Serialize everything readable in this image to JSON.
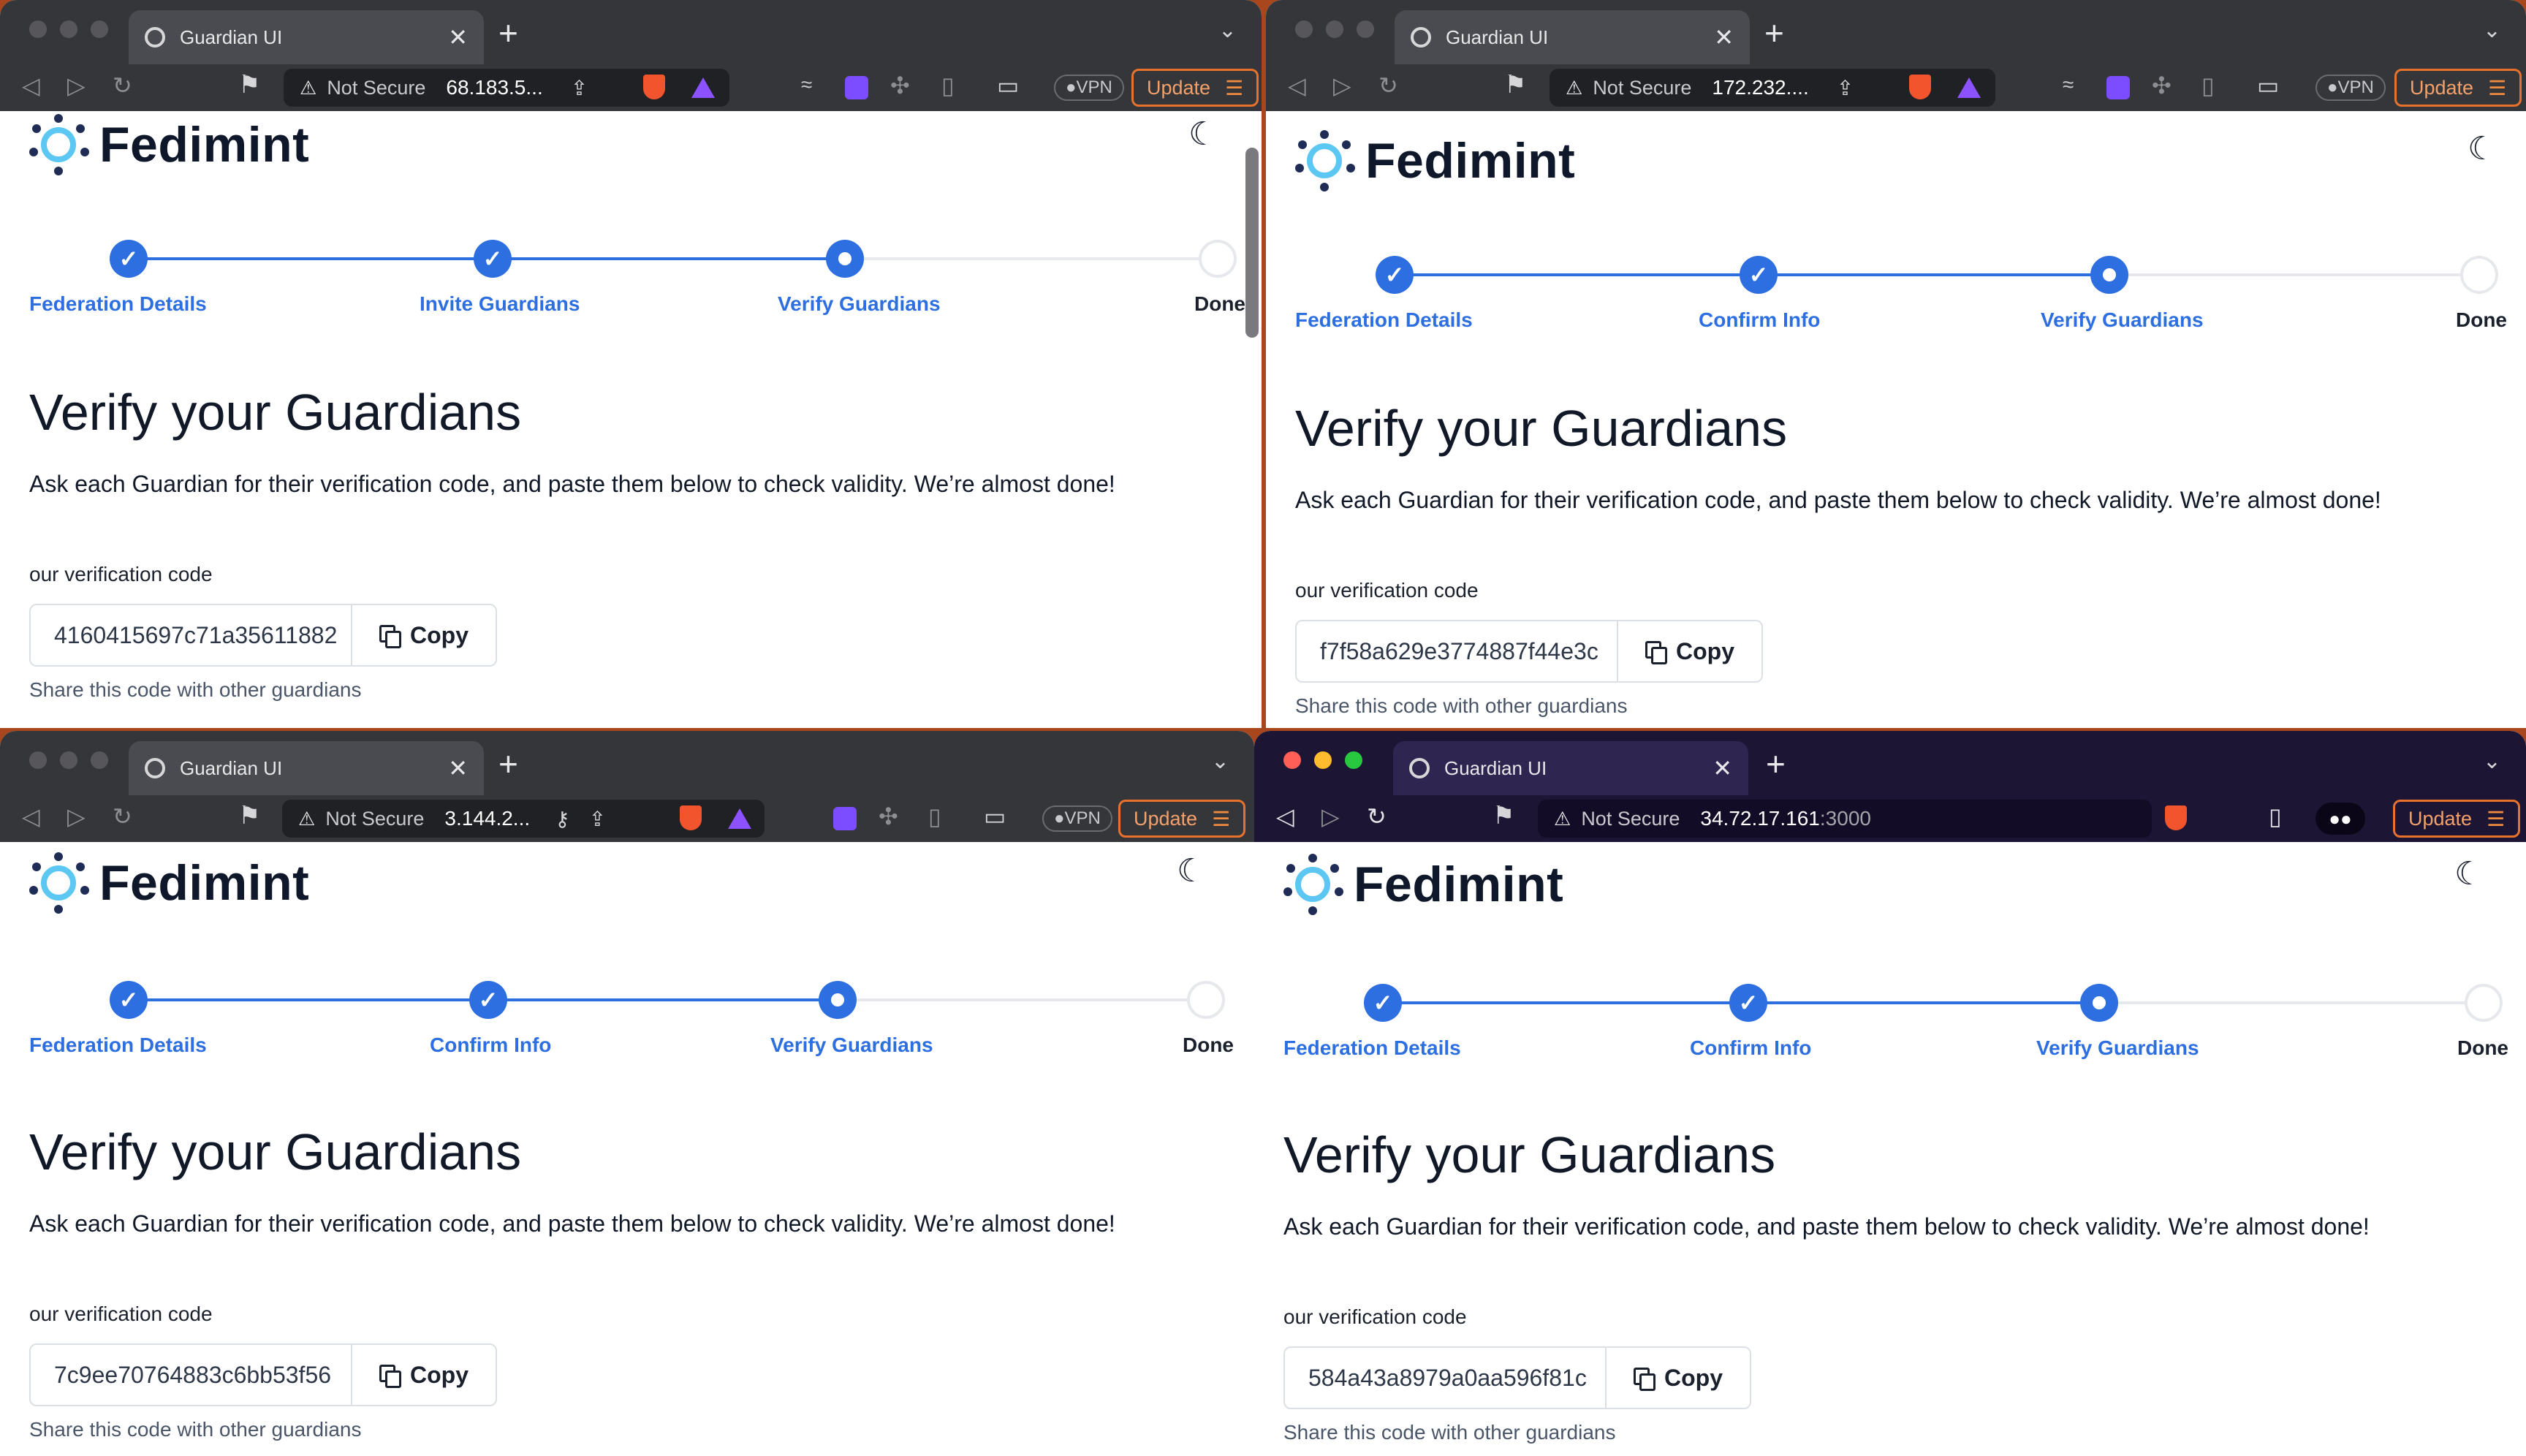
{
  "windows": [
    {
      "tab_title": "Guardian UI",
      "security": "Not Secure",
      "address": "68.183.5...",
      "address_port": "",
      "vpn": "VPN",
      "update": "Update",
      "brand": "Fedimint",
      "steps": [
        "Federation Details",
        "Invite Guardians",
        "Verify Guardians",
        "Done"
      ],
      "heading": "Verify your Guardians",
      "description": "Ask each Guardian for their verification code, and paste them below to check validity. We’re almost done!",
      "code_label": "our verification code",
      "code": "4160415697c71a35611882",
      "copy": "Copy",
      "help": "Share this code with other guardians"
    },
    {
      "tab_title": "Guardian UI",
      "security": "Not Secure",
      "address": "172.232....",
      "address_port": "",
      "vpn": "VPN",
      "update": "Update",
      "brand": "Fedimint",
      "steps": [
        "Federation Details",
        "Confirm Info",
        "Verify Guardians",
        "Done"
      ],
      "heading": "Verify your Guardians",
      "description": "Ask each Guardian for their verification code, and paste them below to check validity. We’re almost done!",
      "code_label": "our verification code",
      "code": "f7f58a629e3774887f44e3c",
      "copy": "Copy",
      "help": "Share this code with other guardians"
    },
    {
      "tab_title": "Guardian UI",
      "security": "Not Secure",
      "address": "3.144.2...",
      "address_port": "",
      "vpn": "VPN",
      "update": "Update",
      "brand": "Fedimint",
      "steps": [
        "Federation Details",
        "Confirm Info",
        "Verify Guardians",
        "Done"
      ],
      "heading": "Verify your Guardians",
      "description": "Ask each Guardian for their verification code, and paste them below to check validity. We’re almost done!",
      "code_label": "our verification code",
      "code": "7c9ee70764883c6bb53f56",
      "copy": "Copy",
      "help": "Share this code with other guardians"
    },
    {
      "tab_title": "Guardian UI",
      "security": "Not Secure",
      "address": "34.72.17.161",
      "address_port": ":3000",
      "vpn": "",
      "update": "Update",
      "brand": "Fedimint",
      "steps": [
        "Federation Details",
        "Confirm Info",
        "Verify Guardians",
        "Done"
      ],
      "heading": "Verify your Guardians",
      "description": "Ask each Guardian for their verification code, and paste them below to check validity. We’re almost done!",
      "code_label": "our verification code",
      "code": "584a43a8979a0aa596f81c",
      "copy": "Copy",
      "help": "Share this code with other guardians"
    }
  ],
  "icons": {
    "back": "◁",
    "forward": "▷",
    "reload": "↻",
    "bookmark": "bookmark-icon",
    "warning": "⚠",
    "share": "share-icon",
    "theme": "moon-icon",
    "menu": "☰"
  },
  "colors": {
    "accent": "#2d6fe0",
    "logo": "#5cc7f2",
    "update_border": "#e8712b",
    "desktop": "#a8471d"
  }
}
